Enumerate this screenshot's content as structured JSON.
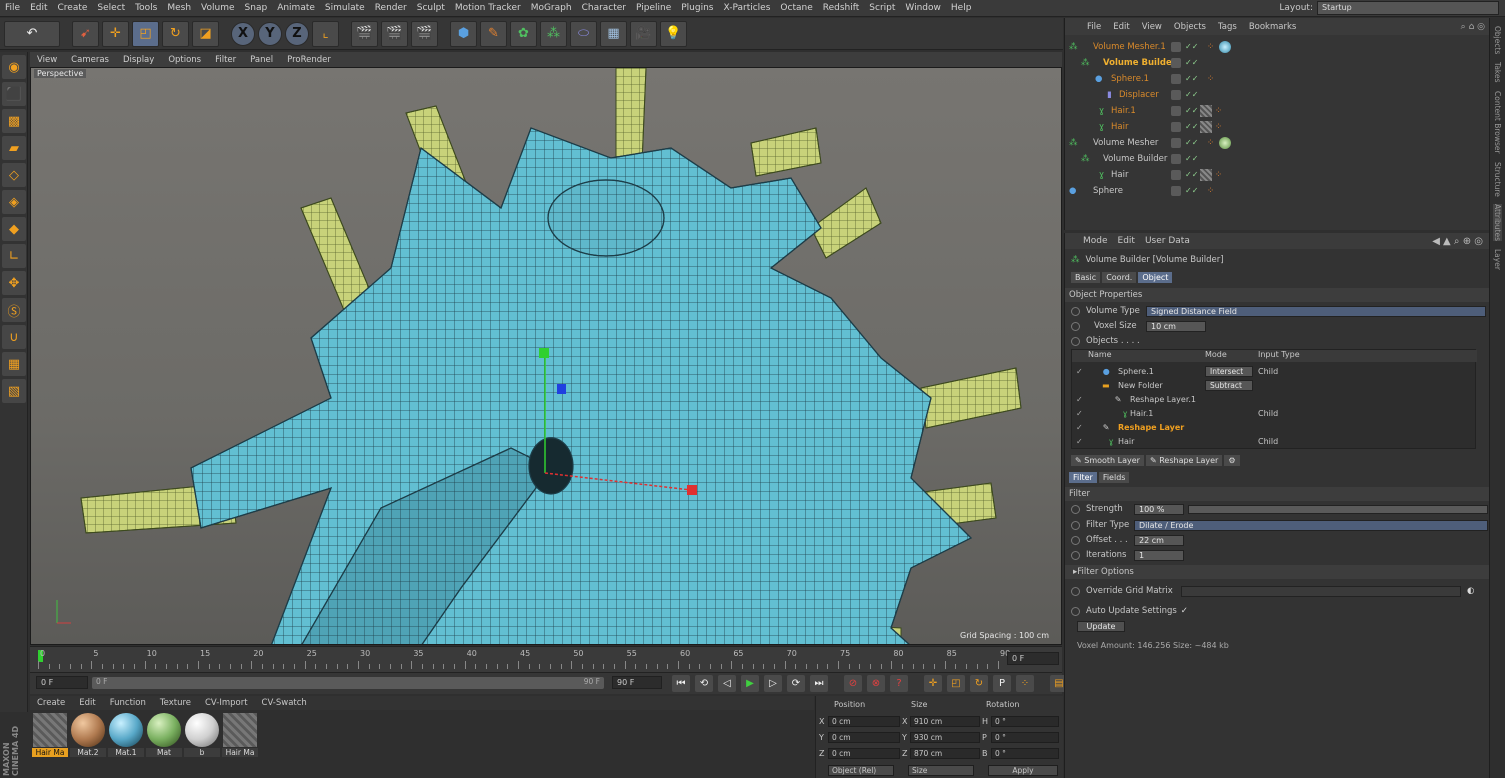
{
  "menubar": {
    "items": [
      "File",
      "Edit",
      "Create",
      "Select",
      "Tools",
      "Mesh",
      "Volume",
      "Snap",
      "Animate",
      "Simulate",
      "Render",
      "Sculpt",
      "Motion Tracker",
      "MoGraph",
      "Character",
      "Pipeline",
      "Plugins",
      "X-Particles",
      "Octane",
      "Redshift",
      "Script",
      "Window",
      "Help"
    ],
    "layout_label": "Layout:",
    "layout_value": "Startup"
  },
  "viewport": {
    "menu": [
      "View",
      "Cameras",
      "Display",
      "Options",
      "Filter",
      "Panel",
      "ProRender"
    ],
    "label": "Perspective",
    "grid_spacing": "Grid Spacing : 100 cm"
  },
  "timeline": {
    "ticks": [
      "0",
      "5",
      "10",
      "15",
      "20",
      "25",
      "30",
      "35",
      "40",
      "45",
      "50",
      "55",
      "60",
      "65",
      "70",
      "75",
      "80",
      "85",
      "90"
    ],
    "current": "0 F",
    "start": "0 F",
    "start2": "0 F",
    "end": "90 F",
    "end2": "90 F"
  },
  "materials": {
    "menu": [
      "Create",
      "Edit",
      "Function",
      "Texture",
      "CV-Import",
      "CV-Swatch"
    ],
    "items": [
      {
        "name": "Hair Ma",
        "color": "#6a6a6a"
      },
      {
        "name": "Mat.2",
        "color": "#b07a50"
      },
      {
        "name": "Mat.1",
        "color": "#58a8c8"
      },
      {
        "name": "Mat",
        "color": "#7ab060"
      },
      {
        "name": "b",
        "color": "#d8d8d8"
      },
      {
        "name": "Hair Ma",
        "color": "#6a6a6a"
      }
    ]
  },
  "brand": {
    "line1": "MAXON",
    "line2": "CINEMA 4D"
  },
  "coords": {
    "headers": [
      "Position",
      "Size",
      "Rotation"
    ],
    "rows": [
      {
        "a": "X",
        "p": "0 cm",
        "s": "910 cm",
        "r_lbl": "H",
        "r": "0 °"
      },
      {
        "a": "Y",
        "p": "0 cm",
        "s": "930 cm",
        "r_lbl": "P",
        "r": "0 °"
      },
      {
        "a": "Z",
        "p": "0 cm",
        "s": "870 cm",
        "r_lbl": "B",
        "r": "0 °"
      }
    ],
    "mode1": "Object (Rel)",
    "mode2": "Size",
    "apply": "Apply"
  },
  "objects": {
    "menu": [
      "File",
      "Edit",
      "View",
      "Objects",
      "Tags",
      "Bookmarks"
    ],
    "rows": [
      {
        "name": "Volume Mesher.1",
        "indent": 0,
        "color": "#d98a2b"
      },
      {
        "name": "Volume Builder",
        "indent": 1,
        "color": "#f0b030"
      },
      {
        "name": "Sphere.1",
        "indent": 2,
        "color": "#d98a2b"
      },
      {
        "name": "Displacer",
        "indent": 3,
        "color": "#d98a2b"
      },
      {
        "name": "Hair.1",
        "indent": 2,
        "color": "#d98a2b"
      },
      {
        "name": "Hair",
        "indent": 2,
        "color": "#d98a2b"
      },
      {
        "name": "Volume Mesher",
        "indent": 0,
        "color": "#cfcfcf"
      },
      {
        "name": "Volume Builder",
        "indent": 1,
        "color": "#cfcfcf"
      },
      {
        "name": "Hair",
        "indent": 2,
        "color": "#cfcfcf"
      },
      {
        "name": "Sphere",
        "indent": 0,
        "color": "#cfcfcf"
      }
    ]
  },
  "attributes": {
    "menu": [
      "Mode",
      "Edit",
      "User Data"
    ],
    "title": "Volume Builder [Volume Builder]",
    "tabs": [
      "Basic",
      "Coord.",
      "Object"
    ],
    "section": "Object Properties",
    "volume_type_label": "Volume Type",
    "volume_type": "Signed Distance Field",
    "voxel_size_label": "Voxel Size",
    "voxel_size": "10 cm",
    "objects_label": "Objects . . . .",
    "list_headers": [
      "Name",
      "Mode",
      "Input Type"
    ],
    "list": [
      {
        "name": "Sphere.1",
        "mode": "Intersect",
        "input": "Child"
      },
      {
        "name": "New Folder",
        "mode": "Subtract",
        "input": ""
      },
      {
        "name": "Reshape Layer.1",
        "mode": "",
        "input": ""
      },
      {
        "name": "Hair.1",
        "mode": "",
        "input": "Child"
      },
      {
        "name": "Reshape Layer",
        "mode": "",
        "input": ""
      },
      {
        "name": "Hair",
        "mode": "",
        "input": "Child"
      }
    ],
    "layer_btns": [
      "Smooth Layer",
      "Reshape Layer"
    ],
    "filter_tabs": [
      "Filter",
      "Fields"
    ],
    "filter_section": "Filter",
    "strength_label": "Strength",
    "strength": "100 %",
    "filter_type_label": "Filter Type",
    "filter_type": "Dilate / Erode",
    "offset_label": "Offset . . .",
    "offset": "22 cm",
    "iterations_label": "Iterations",
    "iterations": "1",
    "filter_options": "Filter Options",
    "override": "Override Grid Matrix",
    "auto_update": "Auto Update Settings",
    "update_btn": "Update",
    "voxel_amount": "Voxel Amount: 146.256   Size: ~484 kb"
  },
  "rightstrip": [
    "Objects",
    "Takes",
    "Content Browser",
    "Structure",
    "Attributes",
    "Layer"
  ]
}
